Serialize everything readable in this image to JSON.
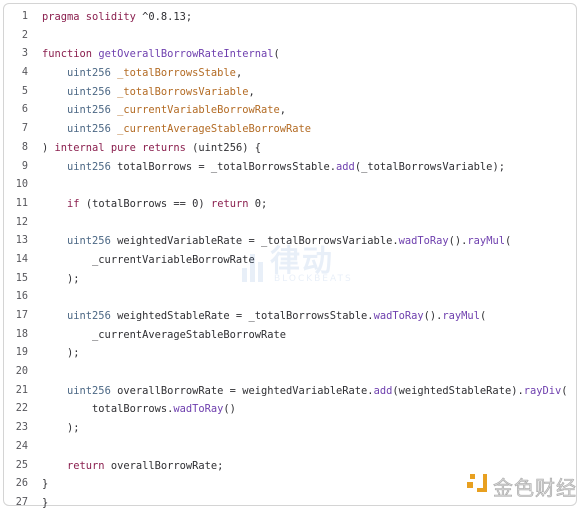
{
  "code": {
    "language": "solidity",
    "lines": [
      {
        "n": "1",
        "tokens": [
          {
            "c": "kw",
            "t": "pragma solidity "
          },
          {
            "c": "tx",
            "t": "^0.8.13;"
          }
        ]
      },
      {
        "n": "2",
        "tokens": []
      },
      {
        "n": "3",
        "tokens": [
          {
            "c": "kw",
            "t": "function "
          },
          {
            "c": "fn",
            "t": "getOverallBorrowRateInternal"
          },
          {
            "c": "tx",
            "t": "("
          }
        ]
      },
      {
        "n": "4",
        "tokens": [
          {
            "c": "tx",
            "t": "    "
          },
          {
            "c": "ty",
            "t": "uint256 "
          },
          {
            "c": "pa",
            "t": "_totalBorrowsStable"
          },
          {
            "c": "tx",
            "t": ","
          }
        ]
      },
      {
        "n": "5",
        "tokens": [
          {
            "c": "tx",
            "t": "    "
          },
          {
            "c": "ty",
            "t": "uint256 "
          },
          {
            "c": "pa",
            "t": "_totalBorrowsVariable"
          },
          {
            "c": "tx",
            "t": ","
          }
        ]
      },
      {
        "n": "6",
        "tokens": [
          {
            "c": "tx",
            "t": "    "
          },
          {
            "c": "ty",
            "t": "uint256 "
          },
          {
            "c": "pa",
            "t": "_currentVariableBorrowRate"
          },
          {
            "c": "tx",
            "t": ","
          }
        ]
      },
      {
        "n": "7",
        "tokens": [
          {
            "c": "tx",
            "t": "    "
          },
          {
            "c": "ty",
            "t": "uint256 "
          },
          {
            "c": "pa",
            "t": "_currentAverageStableBorrowRate"
          }
        ]
      },
      {
        "n": "8",
        "tokens": [
          {
            "c": "tx",
            "t": ") "
          },
          {
            "c": "kw",
            "t": "internal pure returns "
          },
          {
            "c": "tx",
            "t": "(uint256) {"
          }
        ]
      },
      {
        "n": "9",
        "tokens": [
          {
            "c": "tx",
            "t": "    "
          },
          {
            "c": "ty",
            "t": "uint256 "
          },
          {
            "c": "tx",
            "t": "totalBorrows = _totalBorrowsStable."
          },
          {
            "c": "fn",
            "t": "add"
          },
          {
            "c": "tx",
            "t": "(_totalBorrowsVariable);"
          }
        ]
      },
      {
        "n": "10",
        "tokens": []
      },
      {
        "n": "11",
        "tokens": [
          {
            "c": "tx",
            "t": "    "
          },
          {
            "c": "kw",
            "t": "if "
          },
          {
            "c": "tx",
            "t": "(totalBorrows == 0) "
          },
          {
            "c": "kw",
            "t": "return "
          },
          {
            "c": "tx",
            "t": "0;"
          }
        ]
      },
      {
        "n": "12",
        "tokens": []
      },
      {
        "n": "13",
        "tokens": [
          {
            "c": "tx",
            "t": "    "
          },
          {
            "c": "ty",
            "t": "uint256 "
          },
          {
            "c": "tx",
            "t": "weightedVariableRate = _totalBorrowsVariable."
          },
          {
            "c": "fn",
            "t": "wadToRay"
          },
          {
            "c": "tx",
            "t": "()."
          },
          {
            "c": "fn",
            "t": "rayMul"
          },
          {
            "c": "tx",
            "t": "("
          }
        ]
      },
      {
        "n": "14",
        "tokens": [
          {
            "c": "tx",
            "t": "        _currentVariableBorrowRate"
          }
        ]
      },
      {
        "n": "15",
        "tokens": [
          {
            "c": "tx",
            "t": "    );"
          }
        ]
      },
      {
        "n": "16",
        "tokens": []
      },
      {
        "n": "17",
        "tokens": [
          {
            "c": "tx",
            "t": "    "
          },
          {
            "c": "ty",
            "t": "uint256 "
          },
          {
            "c": "tx",
            "t": "weightedStableRate = _totalBorrowsStable."
          },
          {
            "c": "fn",
            "t": "wadToRay"
          },
          {
            "c": "tx",
            "t": "()."
          },
          {
            "c": "fn",
            "t": "rayMul"
          },
          {
            "c": "tx",
            "t": "("
          }
        ]
      },
      {
        "n": "18",
        "tokens": [
          {
            "c": "tx",
            "t": "        _currentAverageStableBorrowRate"
          }
        ]
      },
      {
        "n": "19",
        "tokens": [
          {
            "c": "tx",
            "t": "    );"
          }
        ]
      },
      {
        "n": "20",
        "tokens": []
      },
      {
        "n": "21",
        "tokens": [
          {
            "c": "tx",
            "t": "    "
          },
          {
            "c": "ty",
            "t": "uint256 "
          },
          {
            "c": "tx",
            "t": "overallBorrowRate = weightedVariableRate."
          },
          {
            "c": "fn",
            "t": "add"
          },
          {
            "c": "tx",
            "t": "(weightedStableRate)."
          },
          {
            "c": "fn",
            "t": "rayDiv"
          },
          {
            "c": "tx",
            "t": "("
          }
        ]
      },
      {
        "n": "22",
        "tokens": [
          {
            "c": "tx",
            "t": "        totalBorrows."
          },
          {
            "c": "fn",
            "t": "wadToRay"
          },
          {
            "c": "tx",
            "t": "()"
          }
        ]
      },
      {
        "n": "23",
        "tokens": [
          {
            "c": "tx",
            "t": "    );"
          }
        ]
      },
      {
        "n": "24",
        "tokens": []
      },
      {
        "n": "25",
        "tokens": [
          {
            "c": "tx",
            "t": "    "
          },
          {
            "c": "kw",
            "t": "return "
          },
          {
            "c": "tx",
            "t": "overallBorrowRate;"
          }
        ]
      },
      {
        "n": "26",
        "tokens": [
          {
            "c": "tx",
            "t": "}"
          }
        ]
      },
      {
        "n": "27",
        "tokens": [
          {
            "c": "tx",
            "t": "}"
          }
        ]
      }
    ]
  },
  "watermark": {
    "center_cn": "律动",
    "center_en": "BLOCKBEATS",
    "brand_text": "金色财经"
  },
  "colors": {
    "keyword": "#8a1f4e",
    "function": "#6e3fae",
    "type": "#4b6784",
    "param": "#b36b24",
    "text": "#2f2f33",
    "brand_accent": "#e8a020"
  }
}
